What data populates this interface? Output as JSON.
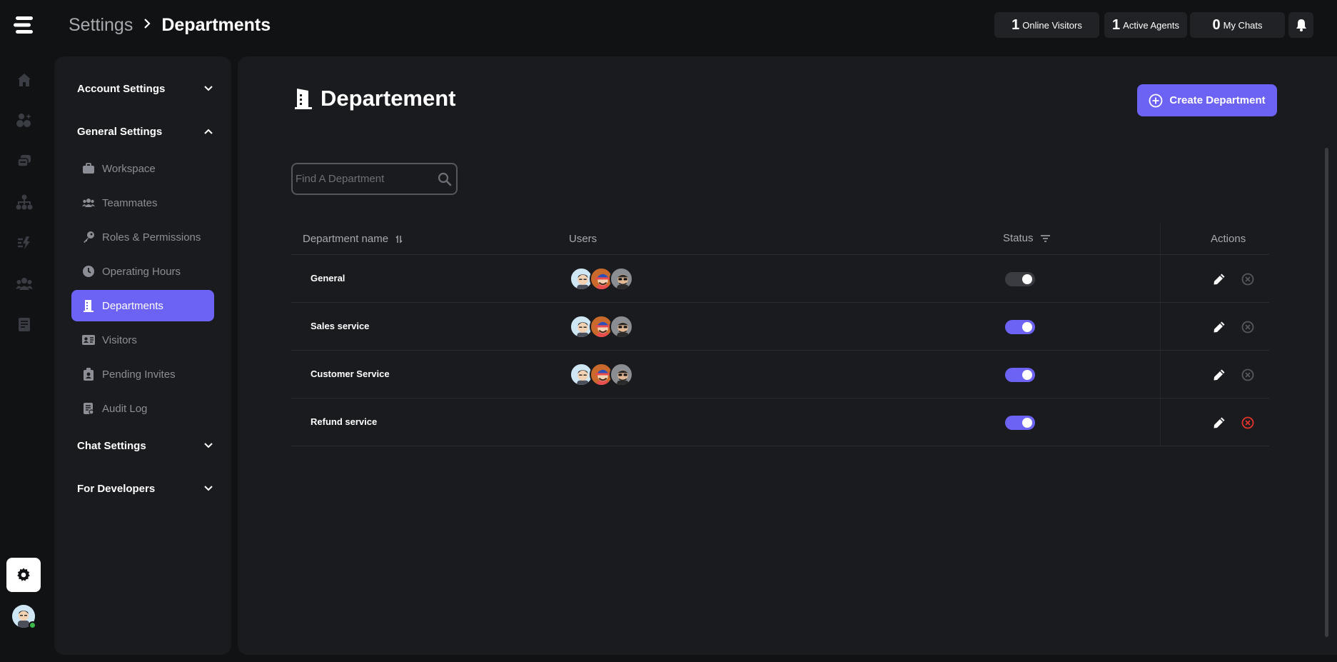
{
  "breadcrumb": {
    "root": "Settings",
    "current": "Departments"
  },
  "stats": [
    {
      "num": "1",
      "label": "Online Visitors"
    },
    {
      "num": "1",
      "label": "Active Agents"
    },
    {
      "num": "0",
      "label": "My Chats"
    }
  ],
  "rail": {
    "icons": [
      "home-icon",
      "apps-icon",
      "chats-icon",
      "org-chart-icon",
      "automation-icon",
      "team-icon",
      "reports-icon"
    ]
  },
  "settings_nav": {
    "account": "Account Settings",
    "general": "General Settings",
    "items": [
      {
        "label": "Workspace",
        "icon": "briefcase-icon"
      },
      {
        "label": "Teammates",
        "icon": "users-icon"
      },
      {
        "label": "Roles & Permissions",
        "icon": "key-icon"
      },
      {
        "label": "Operating Hours",
        "icon": "clock-icon"
      },
      {
        "label": "Departments",
        "icon": "building-icon"
      },
      {
        "label": "Visitors",
        "icon": "id-card-icon"
      },
      {
        "label": "Pending Invites",
        "icon": "invite-icon"
      },
      {
        "label": "Audit Log",
        "icon": "audit-log-icon"
      }
    ],
    "active": "Departments",
    "chat": "Chat Settings",
    "developers": "For Developers"
  },
  "main": {
    "title": "Departement",
    "create_button": "Create Department",
    "search_placeholder": "Find A Department",
    "columns": {
      "name": "Department name",
      "users": "Users",
      "status": "Status",
      "actions": "Actions"
    },
    "rows": [
      {
        "name": "General",
        "has_users": true,
        "status": "off"
      },
      {
        "name": "Sales service",
        "has_users": true,
        "status": "on"
      },
      {
        "name": "Customer Service",
        "has_users": true,
        "status": "on"
      },
      {
        "name": "Refund service",
        "has_users": false,
        "status": "on"
      }
    ]
  },
  "colors": {
    "accent": "#6c63f5",
    "danger": "#e0342a",
    "background": "#111214",
    "panel": "#1a1b1e"
  }
}
